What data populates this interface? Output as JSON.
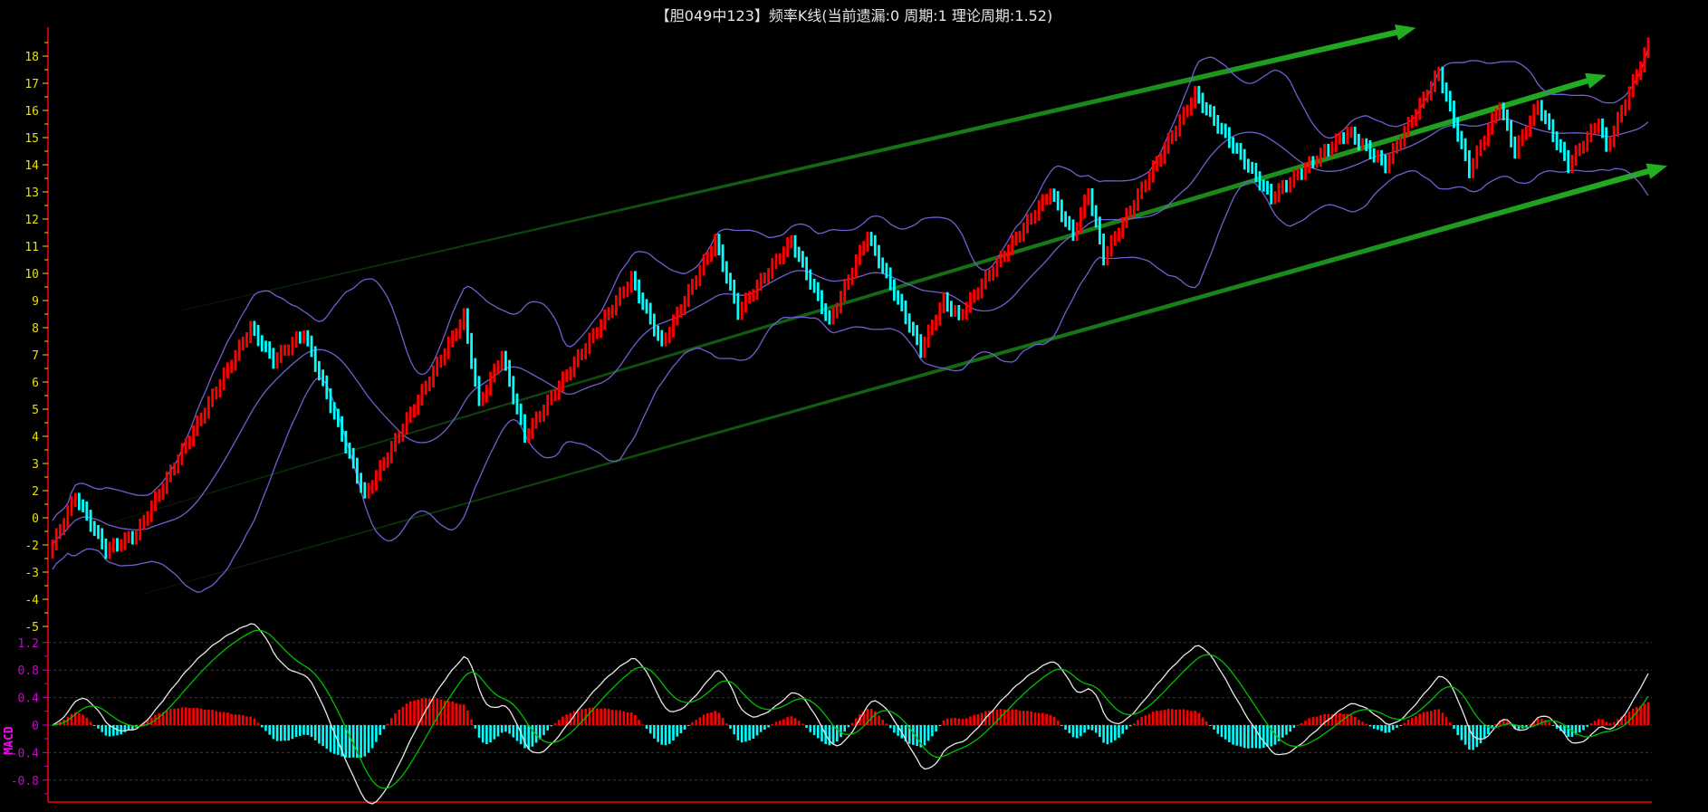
{
  "title": "【胆049中123】频率K线(当前遗漏:0 周期:1 理论周期:1.52)",
  "colors": {
    "up": "#ff0000",
    "down": "#00ffff",
    "band": "#6f5fd0",
    "dif": "#e8e8e8",
    "dea": "#00c000",
    "trend": "#22b022",
    "axis": "#c00000",
    "ytick": "#e8e000",
    "macd_tick": "#d000d0"
  },
  "chart_data": [
    {
      "type": "candlestick",
      "title": "频率K线",
      "bar_count": 420,
      "close_waypoints": [
        [
          0,
          0.0
        ],
        [
          6,
          1.8
        ],
        [
          14,
          -0.2
        ],
        [
          22,
          0.4
        ],
        [
          52,
          8.0
        ],
        [
          58,
          6.8
        ],
        [
          66,
          7.8
        ],
        [
          82,
          1.8
        ],
        [
          108,
          8.4
        ],
        [
          112,
          5.2
        ],
        [
          118,
          7.0
        ],
        [
          124,
          4.0
        ],
        [
          152,
          9.8
        ],
        [
          160,
          7.4
        ],
        [
          174,
          11.2
        ],
        [
          180,
          8.6
        ],
        [
          194,
          11.2
        ],
        [
          204,
          8.2
        ],
        [
          214,
          11.4
        ],
        [
          228,
          7.2
        ],
        [
          234,
          9.0
        ],
        [
          238,
          8.4
        ],
        [
          244,
          9.6
        ],
        [
          262,
          13.0
        ],
        [
          268,
          11.4
        ],
        [
          272,
          13.0
        ],
        [
          276,
          10.6
        ],
        [
          300,
          16.6
        ],
        [
          320,
          12.8
        ],
        [
          340,
          15.2
        ],
        [
          350,
          14.0
        ],
        [
          364,
          17.4
        ],
        [
          372,
          13.8
        ],
        [
          380,
          16.2
        ],
        [
          384,
          14.5
        ],
        [
          390,
          16.2
        ],
        [
          398,
          14.0
        ],
        [
          406,
          15.6
        ],
        [
          408,
          14.6
        ],
        [
          419,
          18.4
        ]
      ],
      "ylim": [
        -3.5,
        19
      ],
      "y_ticks": [
        {
          "value": 18,
          "label": "18"
        },
        {
          "value": 17,
          "label": "17"
        },
        {
          "value": 16,
          "label": "16"
        },
        {
          "value": 15,
          "label": "15"
        },
        {
          "value": 14,
          "label": "14"
        },
        {
          "value": 13,
          "label": "13"
        },
        {
          "value": 12,
          "label": "12"
        },
        {
          "value": 11,
          "label": "11"
        },
        {
          "value": 10,
          "label": "10"
        },
        {
          "value": 9,
          "label": "9"
        },
        {
          "value": 8,
          "label": "8"
        },
        {
          "value": 7,
          "label": "7"
        },
        {
          "value": 6,
          "label": "6"
        },
        {
          "value": 5,
          "label": "5"
        },
        {
          "value": 4,
          "label": "4"
        },
        {
          "value": 3,
          "label": "3"
        },
        {
          "value": 2,
          "label": "2"
        },
        {
          "value": 1,
          "label": "0"
        },
        {
          "value": 0,
          "label": "-2"
        },
        {
          "value": -1,
          "label": "-3"
        },
        {
          "value": -2,
          "label": "-4"
        },
        {
          "value": -3,
          "label": "-5"
        }
      ],
      "overlays": [
        "Bollinger upper",
        "Bollinger middle",
        "Bollinger lower"
      ],
      "trend_lines": [
        {
          "name": "upper-channel",
          "from": [
            34,
            8.64
          ],
          "to": [
            358,
            19.04
          ]
        },
        {
          "name": "middle-channel",
          "from": [
            12,
            0.68
          ],
          "to": [
            408,
            17.3
          ]
        },
        {
          "name": "lower-channel",
          "from": [
            24,
            -1.8
          ],
          "to": [
            424,
            13.96
          ]
        }
      ]
    },
    {
      "type": "line+bar",
      "title": "MACD",
      "ylabel": "MACD",
      "ylim": [
        -1.0,
        1.25
      ],
      "y_ticks": [
        {
          "value": 1.2,
          "label": "1.2"
        },
        {
          "value": 0.8,
          "label": "0.8"
        },
        {
          "value": 0.4,
          "label": "0.4"
        },
        {
          "value": 0,
          "label": "0"
        },
        {
          "value": -0.4,
          "label": "-0.4"
        },
        {
          "value": -0.8,
          "label": "-0.8"
        }
      ],
      "series": [
        {
          "name": "DIF",
          "color": "white"
        },
        {
          "name": "DEA",
          "color": "green"
        },
        {
          "name": "MACD histogram",
          "color": "red/cyan"
        }
      ],
      "grid": true
    }
  ]
}
